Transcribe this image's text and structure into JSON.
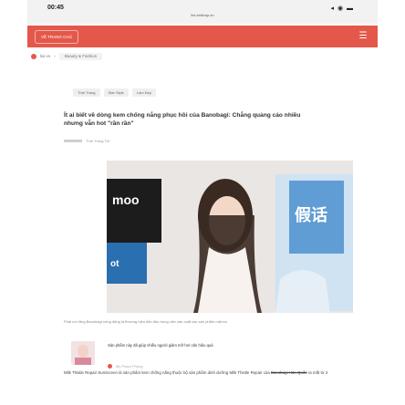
{
  "status": {
    "time": "00:45",
    "signal": "◂ ◉ ▬"
  },
  "url": "lixi.eelshop.vn",
  "nav": {
    "home": "VỀ TRANG CHỦ",
    "menu_icon": "hamburger-icon"
  },
  "breadcrumb": {
    "site": "lixi.vn",
    "category": "Beauty & Fashion"
  },
  "tabs": [
    "Thời Trang",
    "Star Style",
    "Làm Đẹp"
  ],
  "article": {
    "headline": "Ít ai biết về dòng kem chống nắng phục hồi của Banobagi: Chẳng quảng cáo nhiều nhưng vẫn hot \"rần rần\"",
    "meta": "Thời Trang Trẻ",
    "caption": "Phải nói rằng Banobagi xứng đáng là thương hiệu dẫn đầu trong việc sản xuất các sản phẩm mặt nạ.",
    "related": {
      "title": "Sản phẩm này đã giúp nhiều người giảm mỡ hơi căn hiệu quả",
      "source": "My Pham Phong"
    },
    "body_lead": "Milk Thistle Repair SunScreen là sản phẩm kem chống nắng thuộc bộ sản phẩm dinh dưỡng Milk Thistle Repair của ",
    "body_strike": "Banobagi Hàn Quốc",
    "body_tail": " ra mắt từ 2"
  },
  "hero": {
    "brand_a": "moo",
    "brand_b": "ot",
    "brand_c": "假话"
  },
  "colors": {
    "accent": "#e4584b"
  }
}
